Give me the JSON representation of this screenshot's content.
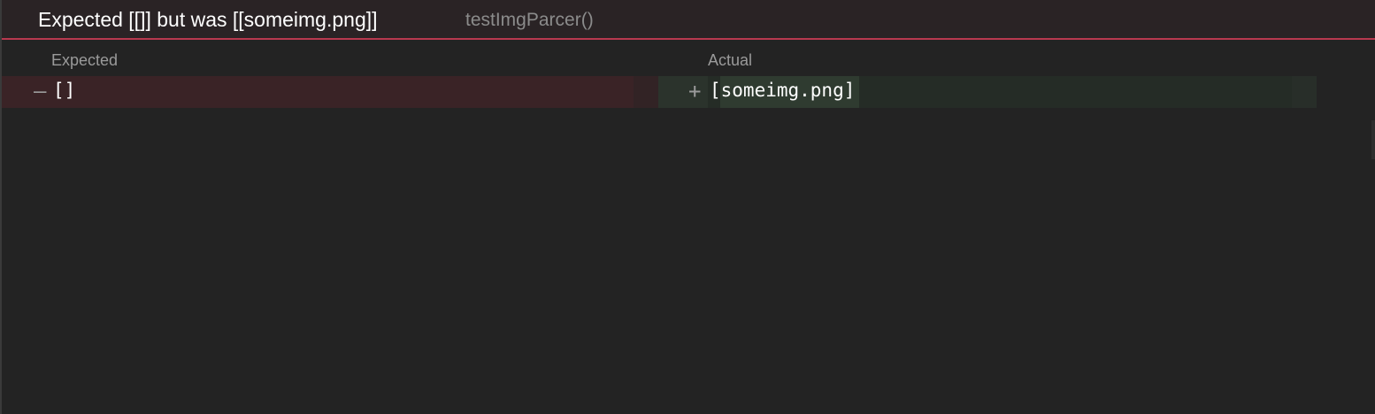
{
  "header": {
    "title": "Expected [[]] but was [[someimg.png]]",
    "test_name": "testImgParcer()"
  },
  "columns": {
    "expected_label": "Expected",
    "actual_label": "Actual"
  },
  "diff": {
    "expected": {
      "marker": "—",
      "value": "[]"
    },
    "actual": {
      "marker": "+",
      "value": "[someimg.png]"
    }
  },
  "colors": {
    "background": "#232323",
    "header_bg": "#2a2325",
    "error_accent": "#b8384f",
    "removed_bg": "#3a2326",
    "added_bg": "#252c26",
    "added_highlight": "#2f3b30"
  }
}
